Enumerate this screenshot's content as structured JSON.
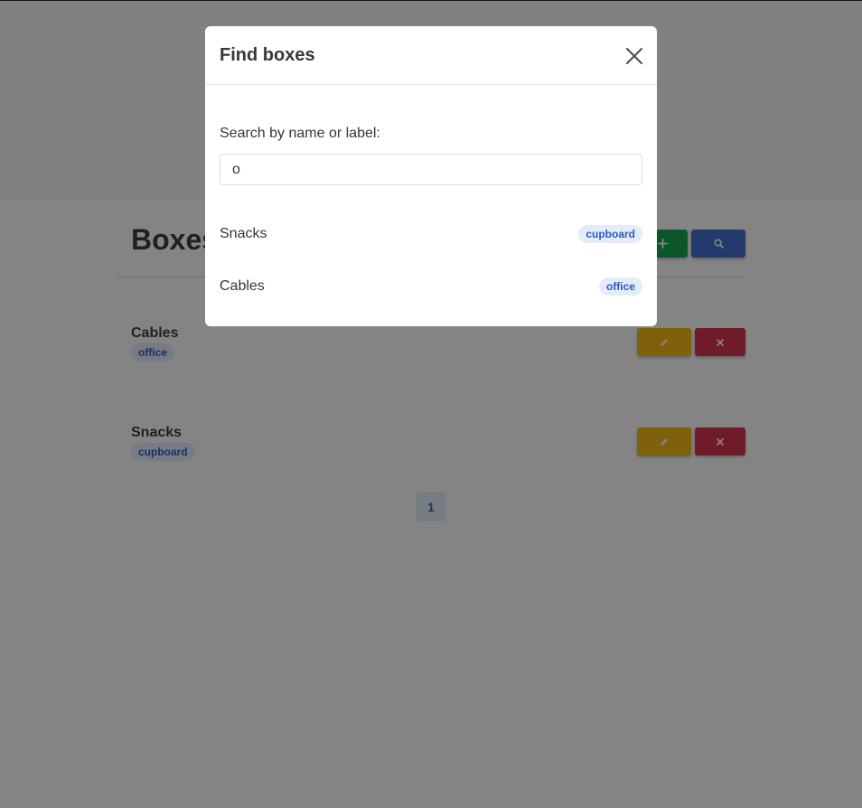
{
  "page": {
    "title": "Boxes",
    "add_icon": "plus-icon",
    "search_icon": "search-icon",
    "edit_icon": "pencil-icon",
    "delete_icon": "close-icon",
    "boxes": [
      {
        "name": "Cables",
        "label": "office"
      },
      {
        "name": "Snacks",
        "label": "cupboard"
      }
    ],
    "pagination": {
      "current_page": "1"
    }
  },
  "modal": {
    "title": "Find boxes",
    "close_icon": "close-icon",
    "search_label": "Search by name or label:",
    "search_value": "o",
    "results": [
      {
        "name": "Snacks",
        "label": "cupboard"
      },
      {
        "name": "Cables",
        "label": "office"
      }
    ]
  },
  "colors": {
    "primary": "#3e6bd1",
    "success": "#0fa54b",
    "warning": "#f5b60c",
    "danger": "#d42c4a",
    "tag_bg": "#e4ecfa",
    "tag_text": "#2b5bc0"
  }
}
